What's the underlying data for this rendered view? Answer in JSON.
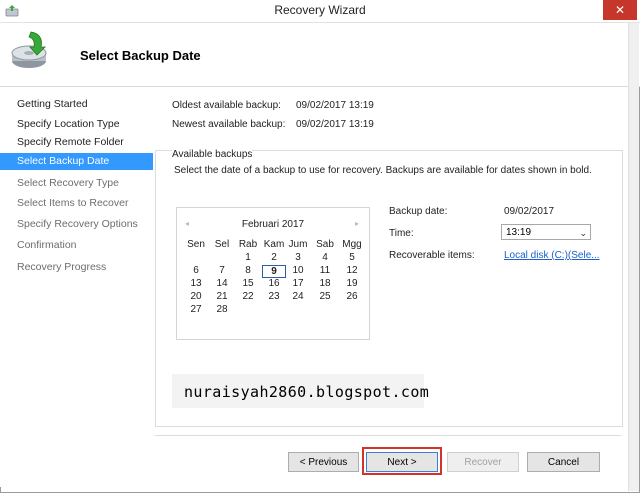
{
  "window": {
    "title": "Recovery Wizard",
    "close_symbol": "✕"
  },
  "header": {
    "heading": "Select Backup Date",
    "icon": "recovery-disk-icon"
  },
  "sidebar": {
    "items": [
      {
        "label": "Getting Started",
        "state": "done"
      },
      {
        "label": "Specify Location Type",
        "state": "done"
      },
      {
        "label": "Specify Remote Folder",
        "state": "done"
      },
      {
        "label": "Select Backup Date",
        "state": "active"
      },
      {
        "label": "Select Recovery Type",
        "state": "disabled"
      },
      {
        "label": "Select Items to Recover",
        "state": "disabled"
      },
      {
        "label": "Specify Recovery Options",
        "state": "disabled"
      },
      {
        "label": "Confirmation",
        "state": "disabled"
      },
      {
        "label": "Recovery Progress",
        "state": "disabled"
      }
    ]
  },
  "info": {
    "oldest_label": "Oldest available backup:",
    "oldest_value": "09/02/2017 13:19",
    "newest_label": "Newest available backup:",
    "newest_value": "09/02/2017 13:19"
  },
  "available": {
    "title": "Available backups",
    "description": "Select the date of a backup to use for recovery. Backups are available for dates shown in bold."
  },
  "calendar": {
    "month": "Februari 2017",
    "prev_symbol": "◂",
    "next_symbol": "▸",
    "weekdays": [
      "Sen",
      "Sel",
      "Rab",
      "Kam",
      "Jum",
      "Sab",
      "Mgg"
    ],
    "weeks": [
      [
        "",
        "",
        "1",
        "2",
        "3",
        "4",
        "5"
      ],
      [
        "6",
        "7",
        "8",
        "9",
        "10",
        "11",
        "12"
      ],
      [
        "13",
        "14",
        "15",
        "16",
        "17",
        "18",
        "19"
      ],
      [
        "20",
        "21",
        "22",
        "23",
        "24",
        "25",
        "26"
      ],
      [
        "27",
        "28",
        "",
        "",
        "",
        "",
        ""
      ]
    ],
    "selected_day": "9"
  },
  "details": {
    "backup_date_label": "Backup date:",
    "backup_date_value": "09/02/2017",
    "time_label": "Time:",
    "time_value": "13:19",
    "recoverable_label": "Recoverable items:",
    "recoverable_link": "Local disk (C:)(Sele..."
  },
  "watermark": {
    "text": "nuraisyah2860.blogspot.com"
  },
  "buttons": {
    "previous": "< Previous",
    "next": "Next >",
    "recover": "Recover",
    "cancel": "Cancel"
  },
  "colors": {
    "active_item": "#3399ff",
    "close_button": "#c7362b",
    "highlight": "#d7312b",
    "link": "#1a5fcf"
  }
}
